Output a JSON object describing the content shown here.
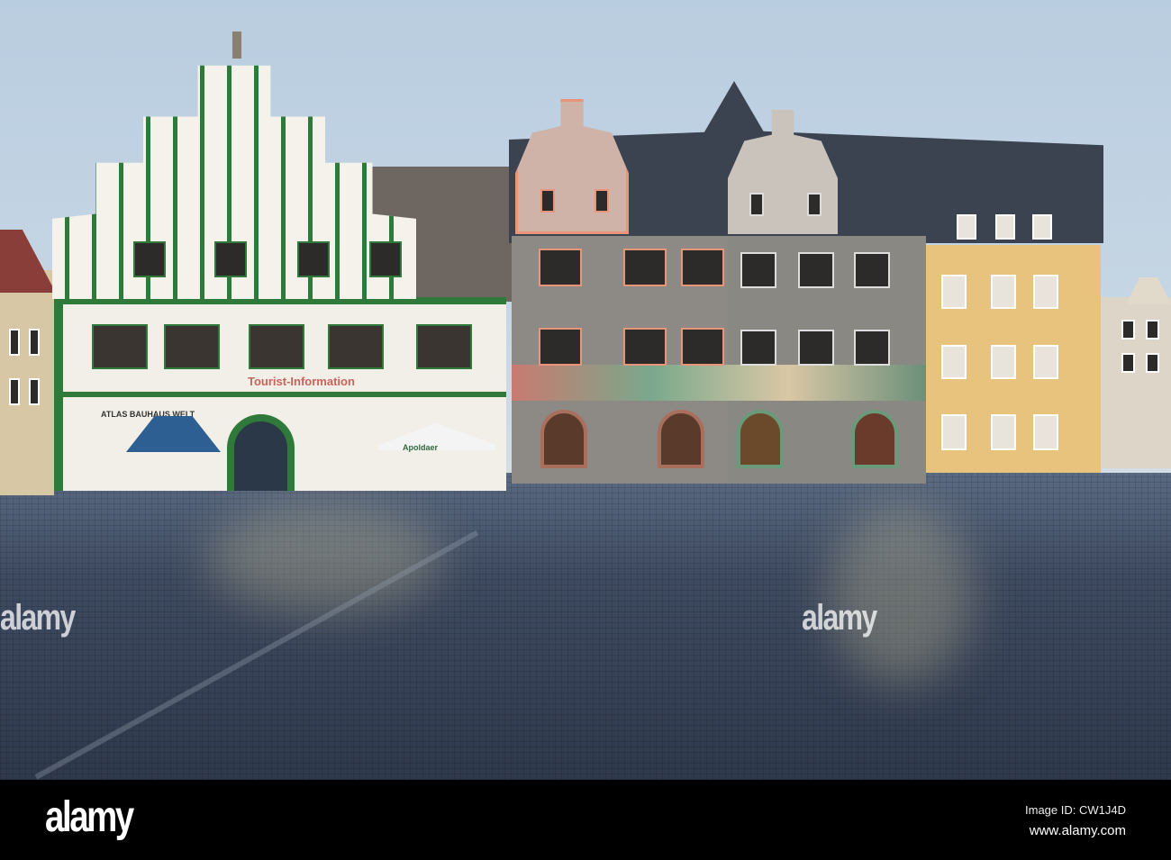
{
  "photo": {
    "signs": {
      "tourist_info": "Tourist-Information",
      "atlas": "ATLAS BAUHAUS WELT",
      "umbrella": "Apoldaer"
    },
    "colors": {
      "sky": "#c6d6e4",
      "townhall_green": "#2f7a3a",
      "trim_orange": "#e8957a",
      "yellow_house": "#e8c37e",
      "gray_house": "#8c8a86",
      "roof": "#3a4250",
      "cobblestone": "#3e4a60"
    }
  },
  "watermarks": {
    "large": "alamy",
    "small": "a"
  },
  "footer": {
    "logo": "alamy",
    "image_id": "Image ID: CW1J4D",
    "website": "www.alamy.com"
  }
}
